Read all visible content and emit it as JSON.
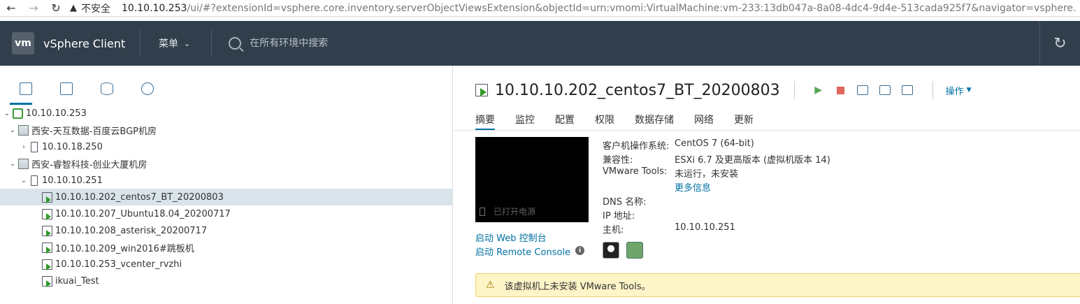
{
  "browser": {
    "back_icon": "arrow-left",
    "forward_icon": "arrow-right",
    "reload_icon": "reload",
    "insecure_label": "不安全",
    "url_host": "10.10.10.253",
    "url_rest": "/ui/#?extensionId=vsphere.core.inventory.serverObjectViewsExtension&objectId=urn:vmomi:VirtualMachine:vm-233:13db047a-8a08-4dc4-9d4e-513cada925f7&navigator=vsphere.core.viTree.hostsAndClust"
  },
  "header": {
    "logo_text": "vm",
    "app_title": "vSphere Client",
    "menu_label": "菜单",
    "search_placeholder": "在所有环境中搜索"
  },
  "tree": {
    "root": "10.10.10.253",
    "datacenters": [
      {
        "name": "西安-天互数据-百度云BGP机房",
        "hosts": [
          "10.10.18.250"
        ]
      },
      {
        "name": "西安-睿智科技-创业大厦机房",
        "hosts": [
          "10.10.10.251"
        ]
      }
    ],
    "vms": [
      "10.10.10.202_centos7_BT_20200803",
      "10.10.10.207_Ubuntu18.04_20200717",
      "10.10.10.208_asterisk_20200717",
      "10.10.10.209_win2016#跳板机",
      "10.10.10.253_vcenter_rvzhi",
      "ikuai_Test"
    ]
  },
  "vm": {
    "title": "10.10.10.202_centos7_BT_20200803",
    "actions_label": "操作",
    "tabs": [
      "摘要",
      "监控",
      "配置",
      "权限",
      "数据存储",
      "网络",
      "更新"
    ],
    "console_status": "已打开电源",
    "launch_web_console": "启动 Web 控制台",
    "launch_remote_console": "启动 Remote Console",
    "info_icon_text": "i",
    "props": {
      "guest_os_label": "客户机操作系统:",
      "guest_os_value": "CentOS 7 (64-bit)",
      "compat_label": "兼容性:",
      "compat_value": "ESXi 6.7 及更高版本 (虚拟机版本 14)",
      "tools_label": "VMware Tools:",
      "tools_value": "未运行，未安装",
      "more_info": "更多信息",
      "dns_label": "DNS 名称:",
      "dns_value": "",
      "ip_label": "IP 地址:",
      "ip_value": "",
      "host_label": "主机:",
      "host_value": "10.10.10.251"
    },
    "alert_text": "该虚拟机上未安装 VMware Tools。"
  }
}
